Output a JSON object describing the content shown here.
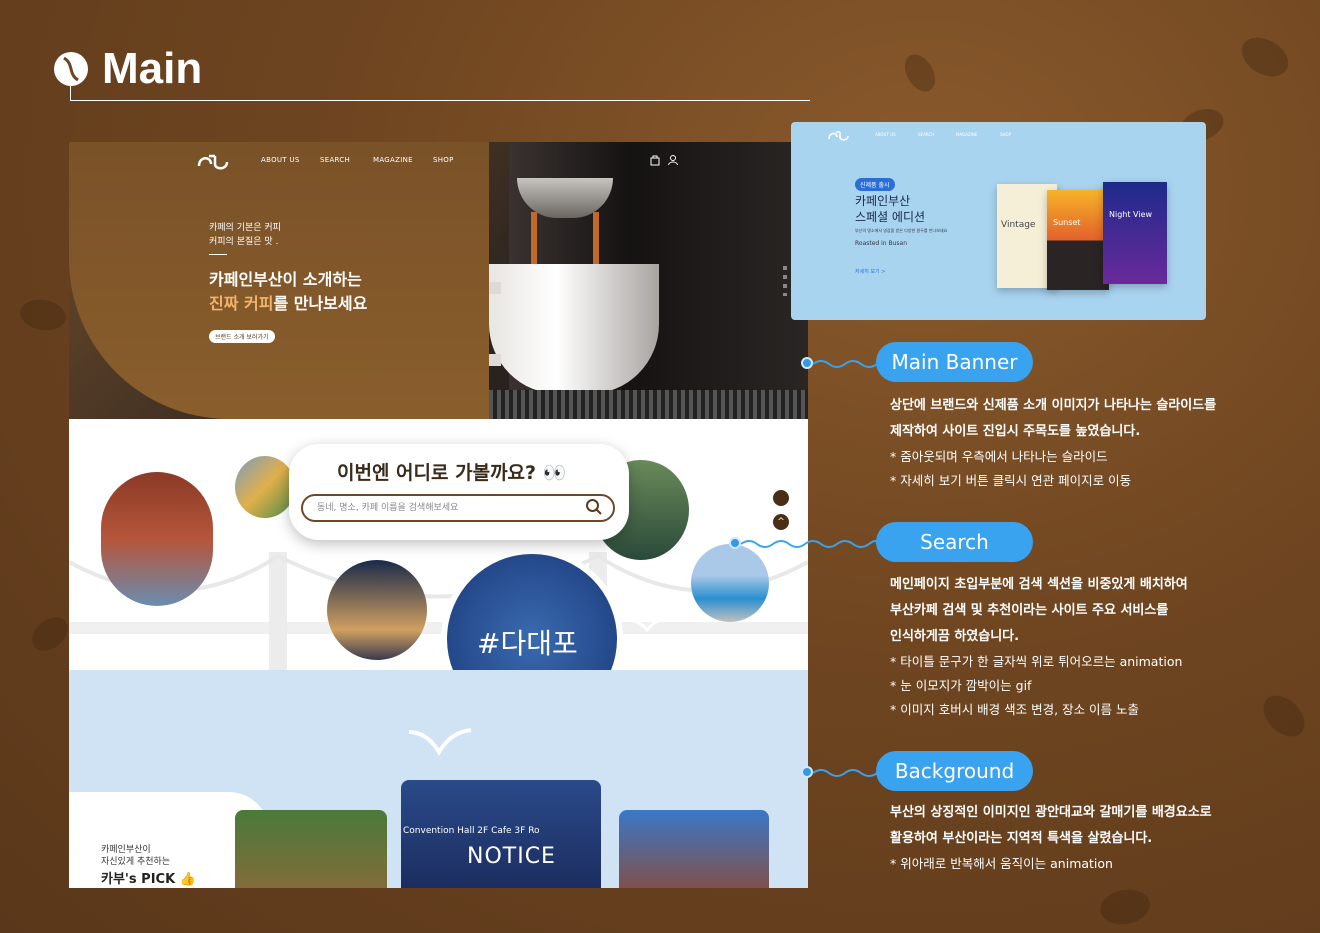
{
  "title": "Main",
  "mock": {
    "nav": [
      "ABOUT US",
      "SEARCH",
      "MAGAZINE",
      "SHOP"
    ],
    "hero_small1": "카페의 기본은 커피",
    "hero_small2": "커피의 본질은 맛 .",
    "hero_title1": "카페인부산이 소개하는",
    "hero_title2a": "진짜 커피",
    "hero_title2b": "를 만나보세요",
    "hero_button": "브랜드 소개 보러가기",
    "search_title": "이번엔 어디로 가볼까요?",
    "search_placeholder": "동네, 명소, 카페 이름을 검색해보세요",
    "hashtag": "#다대포",
    "pick_line1": "카페인부산이",
    "pick_line2": "자신있게 추천하는",
    "pick_title": "카부's PICK",
    "notice_label": "NOTICE",
    "notice_sign": "Convention Hall  2F Cafe  3F Ro"
  },
  "mini": {
    "nav": [
      "ABOUT US",
      "SEARCH",
      "MAGAZINE",
      "SHOP"
    ],
    "badge": "신제품 출시",
    "title1": "카페인부산",
    "title2": "스페셜 에디션",
    "sub": "부산의 명소에서 영감을 받은 다양한 원두를 만나보세요",
    "roasted": "Roasted in Busan",
    "more": "자세히 보기 >",
    "products": [
      "Vintage",
      "Sunset",
      "Night View"
    ]
  },
  "sections": [
    {
      "pill": "Main Banner",
      "lines_bold": [
        "상단에 브랜드와 신제품 소개 이미지가 나타나는 슬라이드를",
        "제작하여 사이트 진입시 주목도를 높였습니다."
      ],
      "lines": [
        "*  줌아웃되며 우측에서 나타나는 슬라이드",
        "*  자세히 보기 버튼 클릭시 연관 페이지로 이동"
      ]
    },
    {
      "pill": "Search",
      "lines_bold": [
        "메인페이지 초입부분에 검색 섹션을 비중있게 배치하여",
        "부산카페 검색 및 추천이라는 사이트 주요 서비스를",
        "인식하게끔 하였습니다."
      ],
      "lines": [
        "* 타이틀 문구가 한 글자씩 위로 튀어오르는 animation",
        "* 눈 이모지가 깜박이는 gif",
        "* 이미지 호버시 배경 색조 변경, 장소 이름 노출"
      ]
    },
    {
      "pill": "Background",
      "lines_bold": [
        "부산의 상징적인 이미지인 광안대교와 갈매기를 배경요소로",
        "활용하여 부산이라는 지역적 특색을 살렸습니다."
      ],
      "lines": [
        "* 위아래로 반복해서 움직이는 animation"
      ]
    }
  ]
}
